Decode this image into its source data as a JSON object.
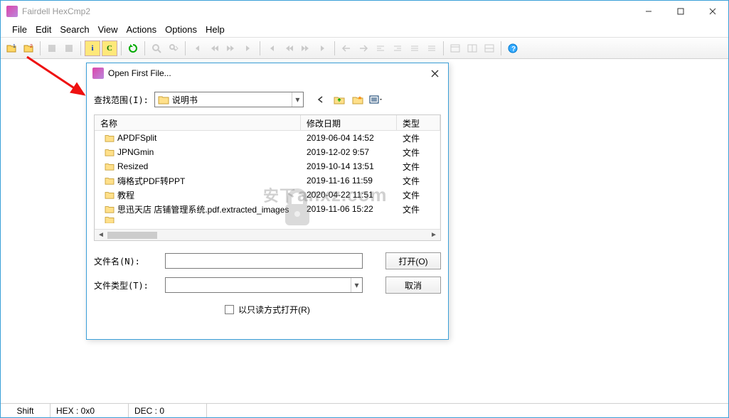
{
  "window": {
    "title": "Fairdell HexCmp2"
  },
  "menu": {
    "items": [
      "File",
      "Edit",
      "Search",
      "View",
      "Actions",
      "Options",
      "Help"
    ]
  },
  "toolbar": {
    "groups": [
      [
        "open-1-icon",
        "open-2-icon"
      ],
      [
        "grey-1",
        "grey-2"
      ],
      [
        "info-i-icon",
        "info-c-icon"
      ],
      [
        "refresh-icon"
      ],
      [
        "find-icon",
        "find-next-icon"
      ],
      [
        "nav-first-icon",
        "nav-prev-icon",
        "nav-next-icon",
        "nav-last-icon"
      ],
      [
        "mark-first-icon",
        "mark-prev-icon",
        "mark-next-icon",
        "mark-last-icon"
      ],
      [
        "sel-left-icon",
        "sel-right-icon",
        "align-left-icon",
        "align-right-icon",
        "list-1-icon",
        "list-2-icon"
      ],
      [
        "panel-1-icon",
        "panel-2-icon",
        "panel-3-icon"
      ],
      [
        "help-icon"
      ]
    ]
  },
  "status": {
    "shift": "Shift",
    "hex": "HEX : 0x0",
    "dec": "DEC : 0"
  },
  "dialog": {
    "title": "Open First File...",
    "lookin_label": "查找范围(I):",
    "lookin_value": "说明书",
    "columns": {
      "name": "名称",
      "date": "修改日期",
      "type": "类型"
    },
    "files": [
      {
        "name": "APDFSplit",
        "date": "2019-06-04 14:52",
        "type": "文件"
      },
      {
        "name": "JPNGmin",
        "date": "2019-12-02 9:57",
        "type": "文件"
      },
      {
        "name": "Resized",
        "date": "2019-10-14 13:51",
        "type": "文件"
      },
      {
        "name": "嗨格式PDF转PPT",
        "date": "2019-11-16 11:59",
        "type": "文件"
      },
      {
        "name": "教程",
        "date": "2020-04-22 11:51",
        "type": "文件"
      },
      {
        "name": "思迅天店 店铺管理系统.pdf.extracted_images",
        "date": "2019-11-06 15:22",
        "type": "文件"
      }
    ],
    "filename_label": "文件名(N):",
    "filetype_label": "文件类型(T):",
    "open_btn": "打开(O)",
    "cancel_btn": "取消",
    "readonly_label": "以只读方式打开(R)"
  },
  "watermark": "anxz.com"
}
